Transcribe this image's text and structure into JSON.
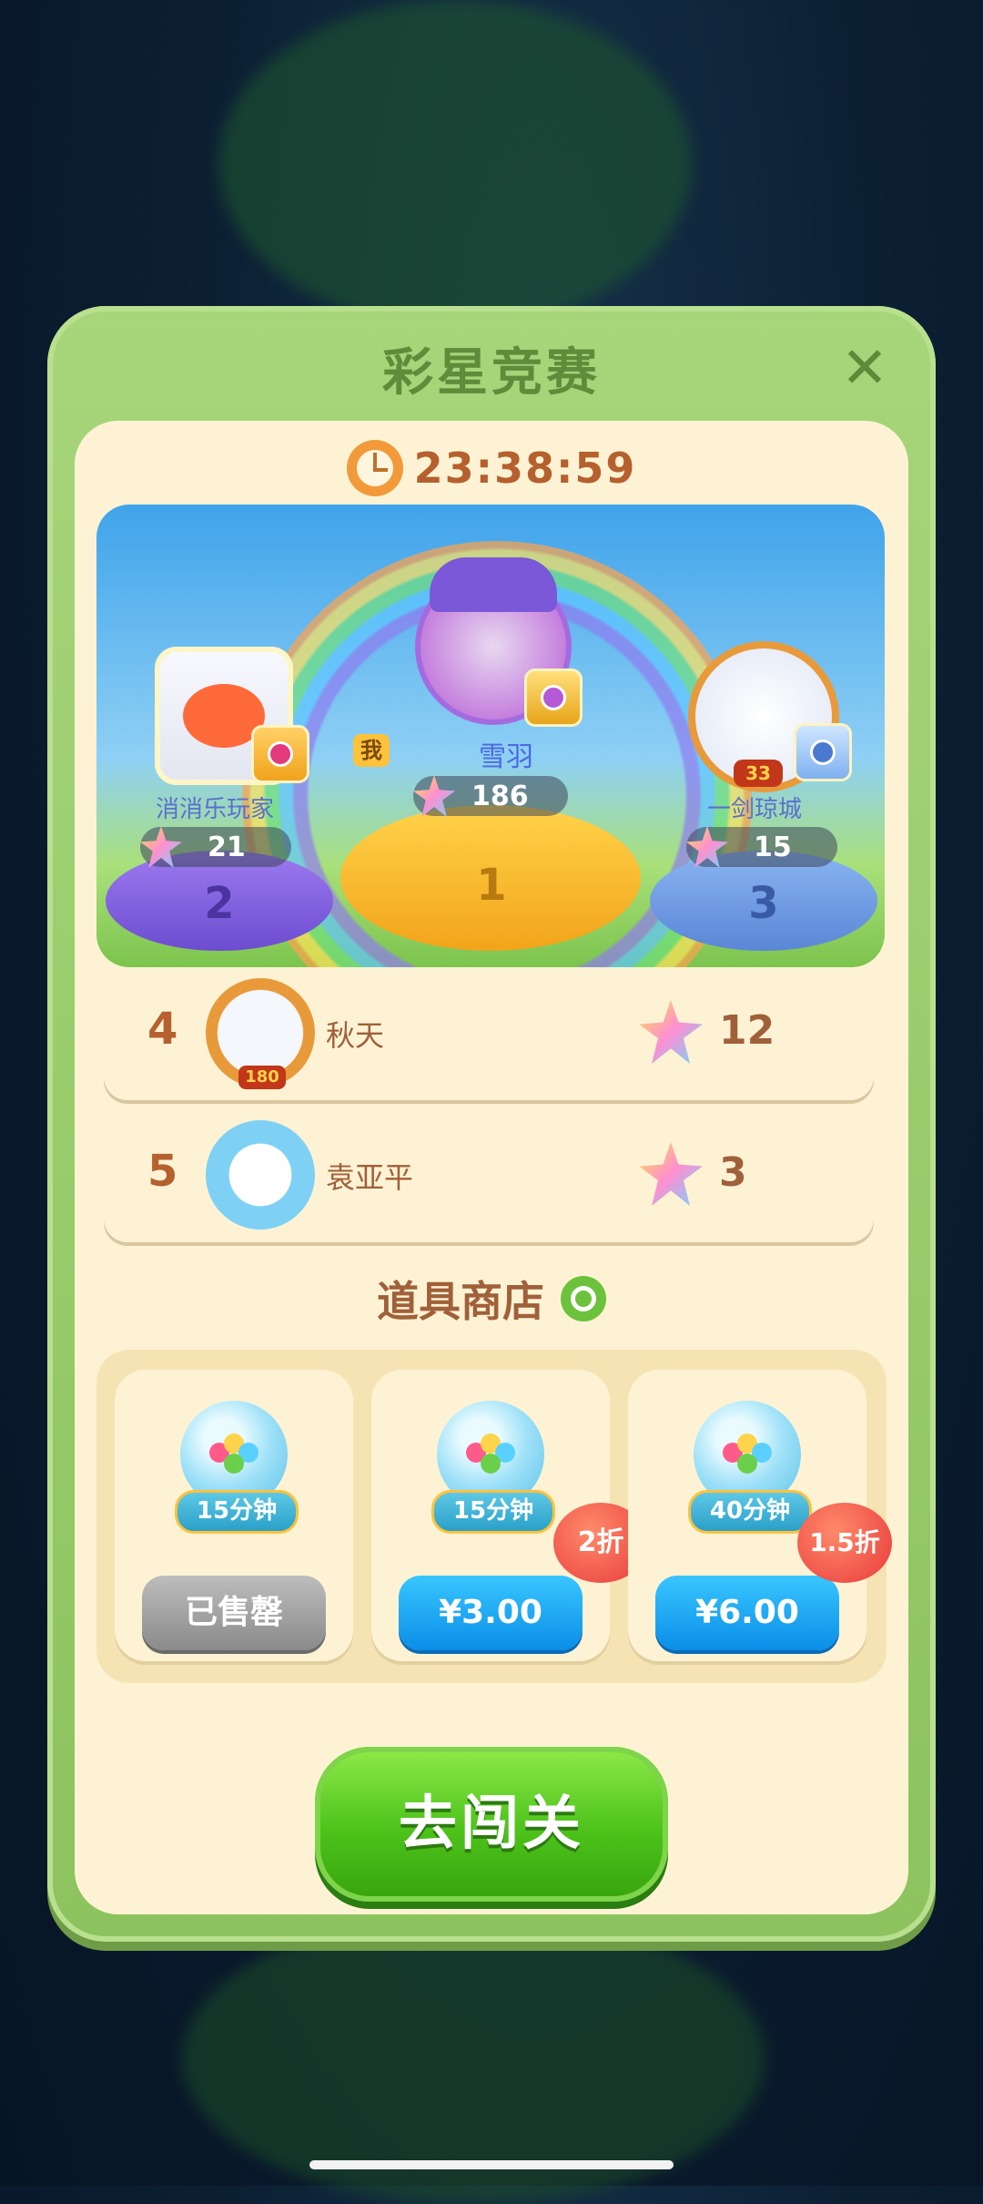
{
  "event": {
    "title": "彩星竞赛",
    "timer": "23:38:59"
  },
  "podium": {
    "first": {
      "me_tag": "我",
      "name": "雪羽",
      "score": "186",
      "rank": "1"
    },
    "second": {
      "name": "消消乐玩家",
      "score": "21",
      "rank": "2"
    },
    "third": {
      "name": "一剑琼城",
      "score": "15",
      "rank": "3",
      "level_badge": "33"
    }
  },
  "leaderboard": [
    {
      "rank": "4",
      "name": "秋天",
      "score": "12",
      "avatar_badge": "180"
    },
    {
      "rank": "5",
      "name": "袁亚平",
      "score": "3"
    }
  ],
  "shop": {
    "title": "道具商店",
    "items": [
      {
        "duration": "15分钟",
        "button": "已售罄",
        "discount": ""
      },
      {
        "duration": "15分钟",
        "button": "¥3.00",
        "discount": "2折"
      },
      {
        "duration": "40分钟",
        "button": "¥6.00",
        "discount": "1.5折"
      }
    ]
  },
  "actions": {
    "go_level": "去闯关"
  },
  "icons": {
    "close": "close-icon",
    "clock": "clock-icon",
    "search": "search-icon",
    "star": "star-icon",
    "chest": "chest-icon"
  },
  "colors": {
    "panel_green": "#8cc35e",
    "title_green": "#5e8c3a",
    "cream": "#fdf3d4",
    "brown_text": "#a0603a",
    "price_blue": "#0a8ee8",
    "go_green": "#4cc21a",
    "discount_red": "#e83a3a"
  }
}
